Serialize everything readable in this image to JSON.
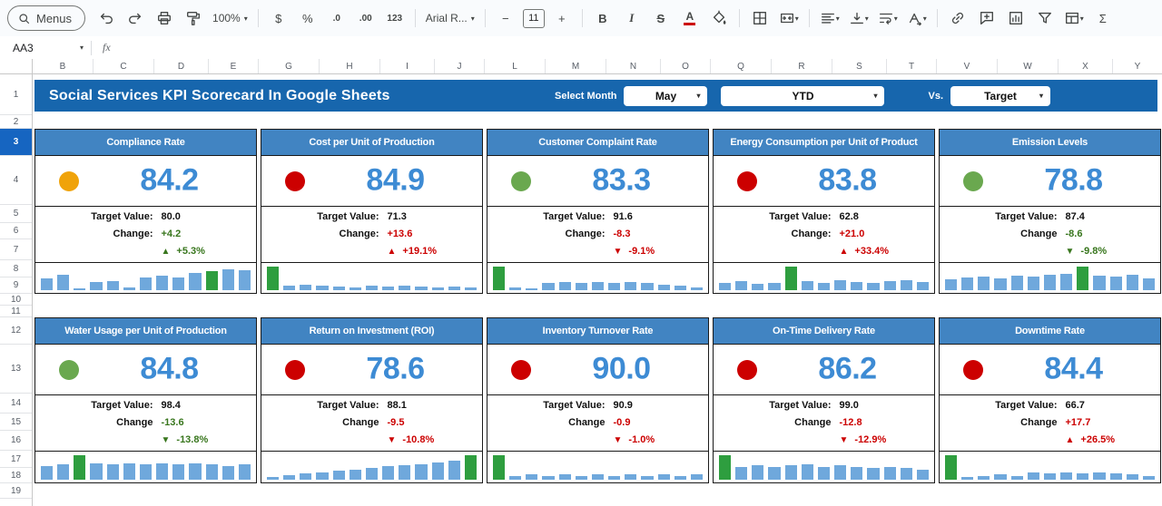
{
  "toolbar": {
    "menus_label": "Menus",
    "zoom": "100%",
    "font_name": "Arial R...",
    "font_size": "11",
    "glyphs": {
      "currency": "$",
      "percent": "%",
      "decrease_decimal": ".0",
      "increase_decimal": ".00",
      "number_format": "123",
      "bold": "B",
      "italic": "I",
      "strikethrough": "S",
      "text_color": "A",
      "minus": "−",
      "plus": "+",
      "sigma": "Σ",
      "caret": "▾"
    }
  },
  "formula_bar": {
    "cell_ref": "AA3",
    "fx_label": "fx"
  },
  "sheet": {
    "columns": [
      "B",
      "C",
      "D",
      "E",
      "G",
      "H",
      "I",
      "J",
      "L",
      "M",
      "N",
      "O",
      "Q",
      "R",
      "S",
      "T",
      "V",
      "W",
      "X",
      "Y"
    ],
    "rows": [
      "1",
      "2",
      "3",
      "4",
      "5",
      "6",
      "7",
      "8",
      "9",
      "10",
      "11",
      "12",
      "13",
      "14",
      "15",
      "16",
      "17",
      "18",
      "19"
    ],
    "selected_row": "3"
  },
  "banner": {
    "title": "Social Services KPI Scorecard In Google Sheets",
    "select_month_label": "Select Month",
    "month": "May",
    "period": "YTD",
    "vs_label": "Vs.",
    "compare": "Target"
  },
  "palette": {
    "banner_bg": "#1766ad",
    "card_header_bg": "#4184c2",
    "value_color": "#3d8bd4",
    "green": "#38761d",
    "red": "#cc0000",
    "bar": "#6fa8dc",
    "bar_highlight": "#2e9e3f",
    "status_yellow": "#f0a30a",
    "status_green": "#6aa84f",
    "status_red": "#cc0000"
  },
  "cards": [
    {
      "title": "Compliance Rate",
      "status": "yellow",
      "value": "84.2",
      "target_label": "Target Value:",
      "target": "80.0",
      "change_label": "Change:",
      "change": "+4.2",
      "change_color": "green",
      "trend": "up",
      "pct": "+5.3%",
      "pct_color": "green",
      "highlight_index": 10,
      "bars": [
        0.5,
        0.62,
        0.06,
        0.33,
        0.38,
        0.1,
        0.52,
        0.58,
        0.52,
        0.72,
        0.78,
        0.85,
        0.8
      ]
    },
    {
      "title": "Cost per Unit of Production",
      "status": "red",
      "value": "84.9",
      "target_label": "Target Value:",
      "target": "71.3",
      "change_label": "Change:",
      "change": "+13.6",
      "change_color": "red",
      "trend": "up",
      "pct": "+19.1%",
      "pct_color": "red",
      "highlight_index": 0,
      "bars": [
        0.95,
        0.18,
        0.22,
        0.18,
        0.14,
        0.1,
        0.2,
        0.15,
        0.2,
        0.14,
        0.1,
        0.15,
        0.1
      ]
    },
    {
      "title": "Customer Complaint Rate",
      "status": "green",
      "value": "83.3",
      "target_label": "Target Value:",
      "target": "91.6",
      "change_label": "Change:",
      "change": "-8.3",
      "change_color": "red",
      "trend": "down",
      "pct": "-9.1%",
      "pct_color": "red",
      "highlight_index": 0,
      "bars": [
        0.95,
        0.12,
        0.08,
        0.28,
        0.33,
        0.28,
        0.33,
        0.3,
        0.33,
        0.28,
        0.24,
        0.18,
        0.1
      ]
    },
    {
      "title": "Energy Consumption per Unit of Product",
      "status": "red",
      "value": "83.8",
      "target_label": "Target Value:",
      "target": "62.8",
      "change_label": "Change:",
      "change": "+21.0",
      "change_color": "red",
      "trend": "up",
      "pct": "+33.4%",
      "pct_color": "red",
      "highlight_index": 4,
      "bars": [
        0.3,
        0.36,
        0.25,
        0.3,
        0.95,
        0.36,
        0.3,
        0.4,
        0.34,
        0.3,
        0.36,
        0.4,
        0.33
      ]
    },
    {
      "title": "Emission Levels",
      "status": "green",
      "value": "78.8",
      "target_label": "Target Value:",
      "target": "87.4",
      "change_label": "Change",
      "change": "-8.6",
      "change_color": "green",
      "trend": "down",
      "pct": "-9.8%",
      "pct_color": "green",
      "highlight_index": 8,
      "bars": [
        0.45,
        0.52,
        0.56,
        0.5,
        0.6,
        0.55,
        0.62,
        0.66,
        0.95,
        0.6,
        0.55,
        0.62,
        0.5
      ]
    },
    {
      "title": "Water Usage per Unit of Production",
      "status": "green",
      "value": "84.8",
      "target_label": "Target Value:",
      "target": "98.4",
      "change_label": "Change",
      "change": "-13.6",
      "change_color": "green",
      "trend": "down",
      "pct": "-13.8%",
      "pct_color": "green",
      "highlight_index": 2,
      "bars": [
        0.55,
        0.62,
        0.95,
        0.66,
        0.6,
        0.66,
        0.6,
        0.66,
        0.6,
        0.66,
        0.6,
        0.55,
        0.6
      ]
    },
    {
      "title": "Return on Investment (ROI)",
      "status": "red",
      "value": "78.6",
      "target_label": "Target Value:",
      "target": "88.1",
      "change_label": "Change",
      "change": "-9.5",
      "change_color": "red",
      "trend": "down",
      "pct": "-10.8%",
      "pct_color": "red",
      "highlight_index": 12,
      "bars": [
        0.1,
        0.18,
        0.24,
        0.3,
        0.35,
        0.4,
        0.46,
        0.52,
        0.57,
        0.62,
        0.68,
        0.74,
        0.95
      ]
    },
    {
      "title": "Inventory Turnover Rate",
      "status": "red",
      "value": "90.0",
      "target_label": "Target Value:",
      "target": "90.9",
      "change_label": "Change",
      "change": "-0.9",
      "change_color": "red",
      "trend": "down",
      "pct": "-1.0%",
      "pct_color": "red",
      "highlight_index": 0,
      "bars": [
        0.95,
        0.14,
        0.2,
        0.15,
        0.2,
        0.15,
        0.2,
        0.15,
        0.2,
        0.15,
        0.2,
        0.15,
        0.2
      ]
    },
    {
      "title": "On-Time Delivery Rate",
      "status": "red",
      "value": "86.2",
      "target_label": "Target Value:",
      "target": "99.0",
      "change_label": "Change",
      "change": "-12.8",
      "change_color": "red",
      "trend": "down",
      "pct": "-12.9%",
      "pct_color": "red",
      "highlight_index": 0,
      "bars": [
        0.95,
        0.5,
        0.56,
        0.5,
        0.56,
        0.6,
        0.5,
        0.56,
        0.5,
        0.46,
        0.5,
        0.46,
        0.4
      ]
    },
    {
      "title": "Downtime Rate",
      "status": "red",
      "value": "84.4",
      "target_label": "Target Value:",
      "target": "66.7",
      "change_label": "Change",
      "change": "+17.7",
      "change_color": "red",
      "trend": "up",
      "pct": "+26.5%",
      "pct_color": "red",
      "highlight_index": 0,
      "bars": [
        0.95,
        0.1,
        0.16,
        0.22,
        0.16,
        0.3,
        0.25,
        0.3,
        0.25,
        0.3,
        0.25,
        0.2,
        0.15
      ]
    }
  ]
}
